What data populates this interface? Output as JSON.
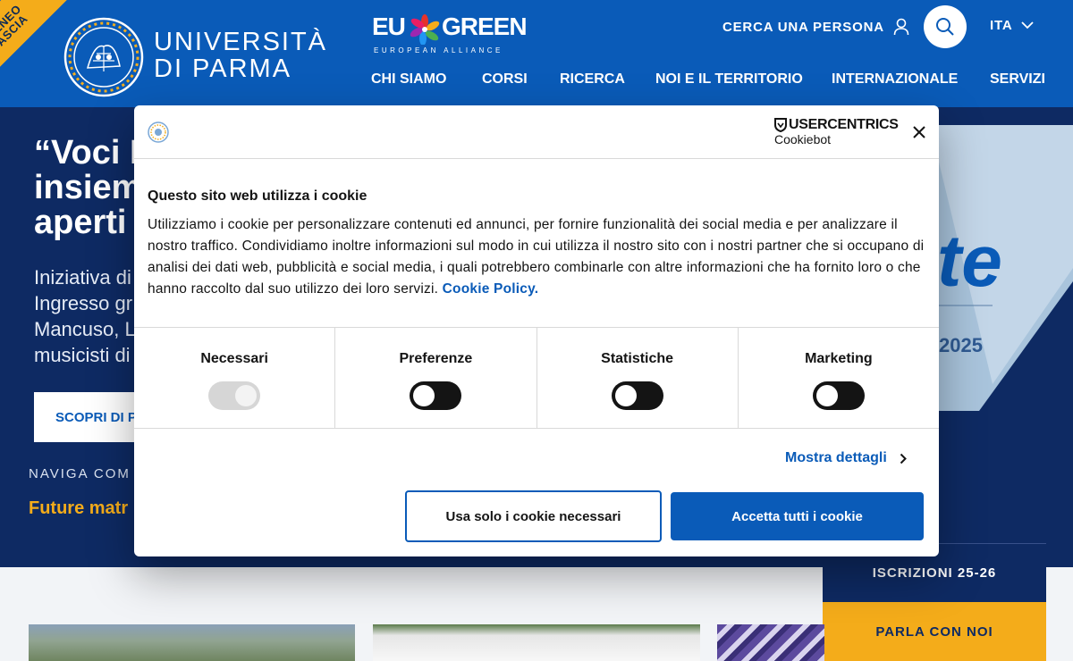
{
  "header": {
    "ribbon_line1": "ATENEO",
    "ribbon_line2": "FASCIA",
    "university_line1": "UNIVERSITÀ",
    "university_line2": "DI PARMA",
    "eu_left": "EU",
    "eu_right": "GREEN",
    "eu_sub": "EUROPEAN ALLIANCE",
    "person_search": "CERCA UNA PERSONA",
    "language": "ITA",
    "nav": [
      {
        "label": "CHI SIAMO"
      },
      {
        "label": "CORSI"
      },
      {
        "label": "RICERCA"
      },
      {
        "label": "NOI E IL TERRITORIO"
      },
      {
        "label": "INTERNAZIONALE"
      },
      {
        "label": "SERVIZI"
      }
    ]
  },
  "hero": {
    "title_line1": "“Voci N",
    "title_line2": "insiem",
    "title_line3": "aperti",
    "text_line1": "Iniziativa di",
    "text_line2": "Ingresso gr",
    "text_line3": "Mancuso, L",
    "text_line4": "musicisti di",
    "button": "SCOPRI DI P",
    "navigate": "NAVIGA COM",
    "future": "Future matr",
    "poster_word": "te",
    "poster_year": "2025"
  },
  "side_cta": {
    "enroll": "ISCRIZIONI 25-26",
    "talk": "PARLA CON NOI"
  },
  "cookie": {
    "brand_top": "USERCENTRICS",
    "brand_bottom": "Cookiebot",
    "title": "Questo sito web utilizza i cookie",
    "body": "Utilizziamo i cookie per personalizzare contenuti ed annunci, per fornire funzionalità dei social media e per analizzare il nostro traffico. Condividiamo inoltre informazioni sul modo in cui utilizza il nostro sito con i nostri partner che si occupano di analisi dei dati web, pubblicità e social media, i quali potrebbero combinarle con altre informazioni che ha fornito loro o che hanno raccolto dal suo utilizzo dei loro servizi.",
    "policy_link": "Cookie Policy.",
    "categories": [
      {
        "label": "Necessari",
        "state": "on-disabled"
      },
      {
        "label": "Preferenze",
        "state": "off"
      },
      {
        "label": "Statistiche",
        "state": "off"
      },
      {
        "label": "Marketing",
        "state": "off"
      }
    ],
    "details_link": "Mostra dettagli",
    "btn_necessary": "Usa solo i cookie necessari",
    "btn_accept": "Accetta tutti i cookie"
  },
  "colors": {
    "brand_blue": "#0a5bb8",
    "navy": "#0e2a63",
    "accent_yellow": "#f4ac1a"
  }
}
